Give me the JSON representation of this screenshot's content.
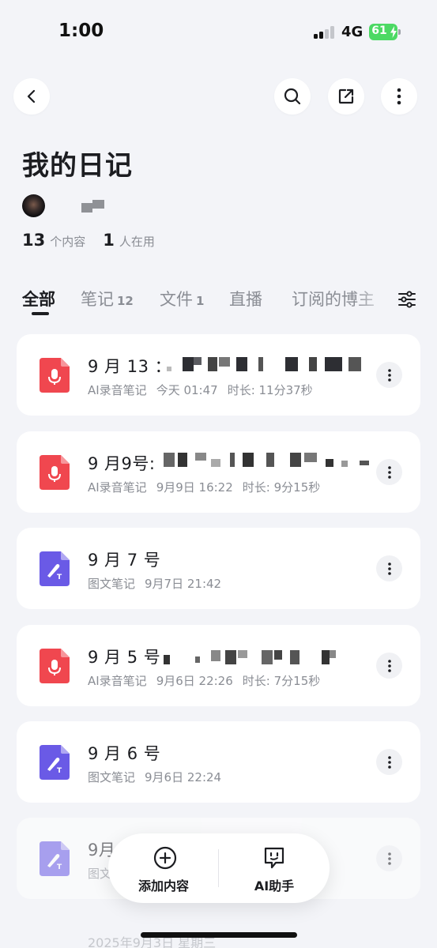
{
  "status_bar": {
    "time": "1:00",
    "network": "4G",
    "battery": "61"
  },
  "header": {
    "title": "我的日记"
  },
  "stats": [
    {
      "num": "13",
      "label": "个内容"
    },
    {
      "num": "1",
      "label": "人在用"
    }
  ],
  "tabs": [
    {
      "label": "全部",
      "count": ""
    },
    {
      "label": "笔记",
      "count": "12"
    },
    {
      "label": "文件",
      "count": "1"
    },
    {
      "label": "直播",
      "count": ""
    },
    {
      "label": "订阅的博主",
      "count": ""
    }
  ],
  "cards": [
    {
      "type": "audio",
      "title": "9 月 13 ：",
      "kind": "AI录音笔记",
      "date": "今天 01:47",
      "duration": "时长: 11分37秒"
    },
    {
      "type": "audio",
      "title": "9 月9号:",
      "kind": "AI录音笔记",
      "date": "9月9日 16:22",
      "duration": "时长: 9分15秒"
    },
    {
      "type": "doc",
      "title": "9 月 7 号",
      "kind": "图文笔记",
      "date": "9月7日 21:42",
      "duration": ""
    },
    {
      "type": "audio",
      "title": "9 月 5 号",
      "kind": "AI录音笔记",
      "date": "9月6日 22:26",
      "duration": "时长: 7分15秒"
    },
    {
      "type": "doc",
      "title": "9 月 6 号",
      "kind": "图文笔记",
      "date": "9月6日 22:24",
      "duration": ""
    },
    {
      "type": "doc",
      "title": "9月",
      "kind": "图文",
      "date": "",
      "duration": ""
    }
  ],
  "fab": {
    "add_label": "添加内容",
    "ai_label": "AI助手"
  },
  "bottom_peek": "2025年9月3日 星期三",
  "colors": {
    "audio_icon": "#f0474f",
    "doc_icon": "#6a5ae6",
    "battery": "#4cd964"
  }
}
